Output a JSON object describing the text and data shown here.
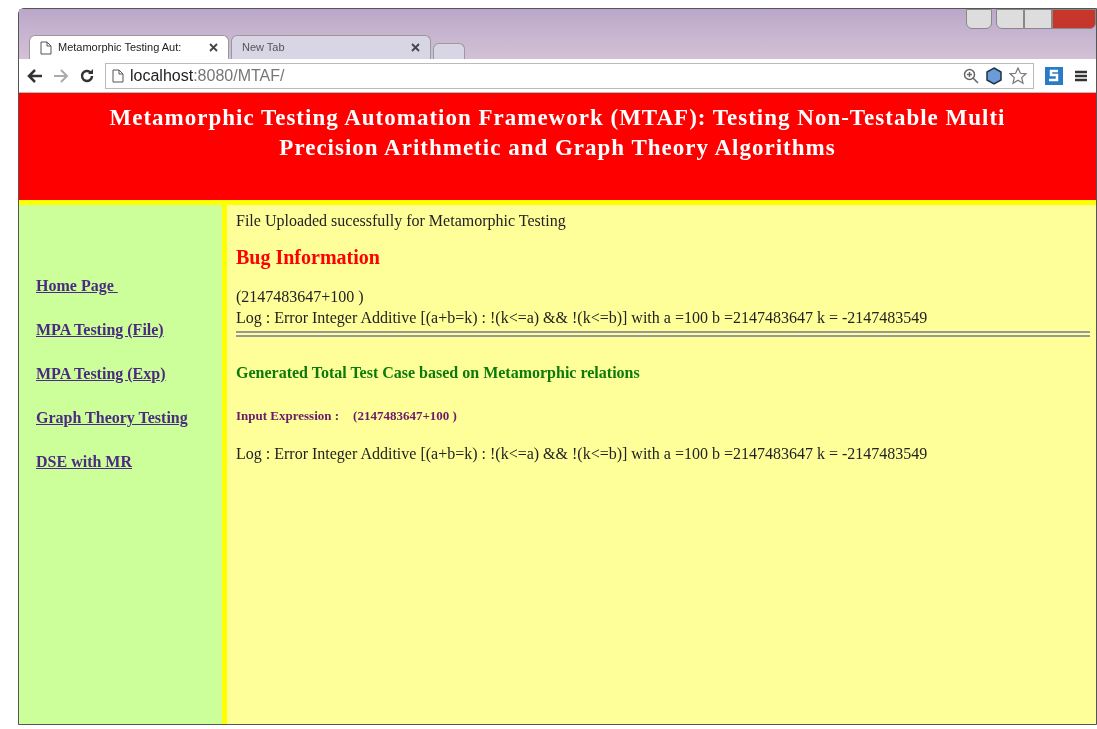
{
  "browser": {
    "tabs": [
      {
        "title": "Metamorphic Testing Aut:",
        "selected": true
      },
      {
        "title": "New Tab",
        "selected": false
      }
    ],
    "address": {
      "host": "localhost",
      "rest": ":8080/MTAF/"
    }
  },
  "header": {
    "title": "Metamorphic Testing Automation Framework (MTAF): Testing Non-Testable Multi Precision Arithmetic and Graph Theory Algorithms"
  },
  "sidebar": {
    "links": [
      "Home Page ",
      "MPA Testing (File)",
      "MPA Testing (Exp)",
      "Graph Theory Testing",
      "DSE with MR"
    ]
  },
  "content": {
    "status": "File Uploaded sucessfully for Metamorphic Testing",
    "bug_heading": "Bug Information",
    "expression": "(2147483647+100 )",
    "log": "Log : Error Integer Additive [(a+b=k) : !(k<=a) && !(k<=b)] with a =100 b =2147483647 k = -2147483549",
    "generated_heading": "Generated Total Test Case based on Metamorphic relations",
    "input_label": "Input Expression :",
    "input_value": "(2147483647+100 )",
    "log2": "Log : Error Integer Additive [(a+b=k) : !(k<=a) && !(k<=b)] with a =100 b =2147483647 k = -2147483549"
  }
}
